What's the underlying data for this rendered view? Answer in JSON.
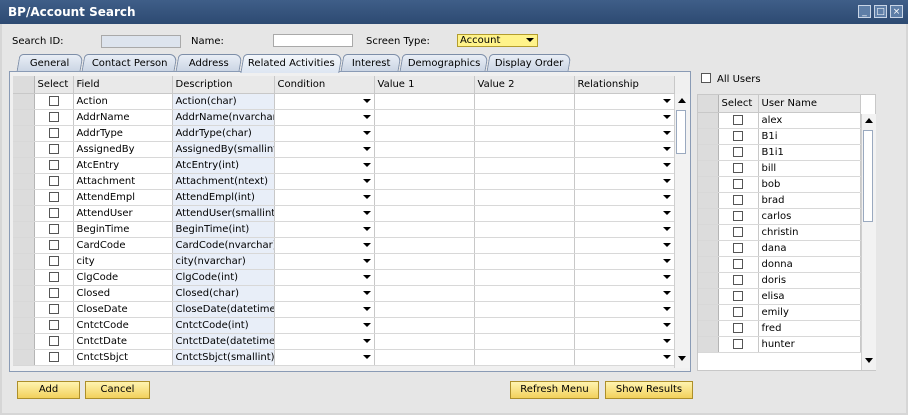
{
  "window": {
    "title": "BP/Account Search"
  },
  "search": {
    "id_label": "Search ID:",
    "id_value": "",
    "name_label": "Name:",
    "name_value": "",
    "screen_type_label": "Screen Type:",
    "screen_type_value": "Account"
  },
  "tabs": [
    {
      "label": "General"
    },
    {
      "label": "Contact Person"
    },
    {
      "label": "Address"
    },
    {
      "label": "Related Activities"
    },
    {
      "label": "Interest"
    },
    {
      "label": "Demographics"
    },
    {
      "label": "Display Order"
    }
  ],
  "grid": {
    "headers": [
      "Select",
      "Field",
      "Description",
      "Condition",
      "Value 1",
      "Value 2",
      "Relationship"
    ],
    "rows": [
      {
        "field": "Action",
        "description": "Action(char)"
      },
      {
        "field": "AddrName",
        "description": "AddrName(nvarchar)"
      },
      {
        "field": "AddrType",
        "description": "AddrType(char)"
      },
      {
        "field": "AssignedBy",
        "description": "AssignedBy(smallint)"
      },
      {
        "field": "AtcEntry",
        "description": "AtcEntry(int)"
      },
      {
        "field": "Attachment",
        "description": "Attachment(ntext)"
      },
      {
        "field": "AttendEmpl",
        "description": "AttendEmpl(int)"
      },
      {
        "field": "AttendUser",
        "description": "AttendUser(smallint)"
      },
      {
        "field": "BeginTime",
        "description": "BeginTime(int)"
      },
      {
        "field": "CardCode",
        "description": "CardCode(nvarchar)"
      },
      {
        "field": "city",
        "description": "city(nvarchar)"
      },
      {
        "field": "ClgCode",
        "description": "ClgCode(int)"
      },
      {
        "field": "Closed",
        "description": "Closed(char)"
      },
      {
        "field": "CloseDate",
        "description": "CloseDate(datetime)"
      },
      {
        "field": "CntctCode",
        "description": "CntctCode(int)"
      },
      {
        "field": "CntctDate",
        "description": "CntctDate(datetime)"
      },
      {
        "field": "CntctSbjct",
        "description": "CntctSbjct(smallint)"
      }
    ]
  },
  "users": {
    "all_users_label": "All Users",
    "headers": [
      "Select",
      "User Name"
    ],
    "rows": [
      "alex",
      "B1i",
      "B1i1",
      "bill",
      "bob",
      "brad",
      "carlos",
      "christin",
      "dana",
      "donna",
      "doris",
      "elisa",
      "emily",
      "fred",
      "hunter"
    ]
  },
  "buttons": {
    "add": "Add",
    "cancel": "Cancel",
    "refresh_menu": "Refresh Menu",
    "show_results": "Show Results"
  },
  "colors": {
    "accent": "#2d4a72",
    "button": "#f2d15c",
    "screen_type_bg": "#fff38a"
  }
}
